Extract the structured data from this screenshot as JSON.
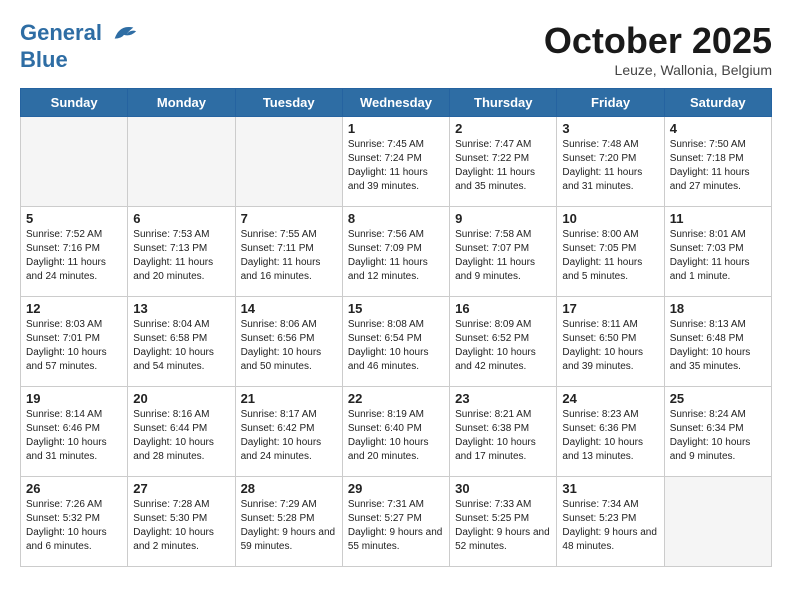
{
  "header": {
    "logo_line1": "General",
    "logo_line2": "Blue",
    "month": "October 2025",
    "location": "Leuze, Wallonia, Belgium"
  },
  "weekdays": [
    "Sunday",
    "Monday",
    "Tuesday",
    "Wednesday",
    "Thursday",
    "Friday",
    "Saturday"
  ],
  "weeks": [
    [
      {
        "day": null
      },
      {
        "day": null
      },
      {
        "day": null
      },
      {
        "day": "1",
        "sunrise": "Sunrise: 7:45 AM",
        "sunset": "Sunset: 7:24 PM",
        "daylight": "Daylight: 11 hours and 39 minutes."
      },
      {
        "day": "2",
        "sunrise": "Sunrise: 7:47 AM",
        "sunset": "Sunset: 7:22 PM",
        "daylight": "Daylight: 11 hours and 35 minutes."
      },
      {
        "day": "3",
        "sunrise": "Sunrise: 7:48 AM",
        "sunset": "Sunset: 7:20 PM",
        "daylight": "Daylight: 11 hours and 31 minutes."
      },
      {
        "day": "4",
        "sunrise": "Sunrise: 7:50 AM",
        "sunset": "Sunset: 7:18 PM",
        "daylight": "Daylight: 11 hours and 27 minutes."
      }
    ],
    [
      {
        "day": "5",
        "sunrise": "Sunrise: 7:52 AM",
        "sunset": "Sunset: 7:16 PM",
        "daylight": "Daylight: 11 hours and 24 minutes."
      },
      {
        "day": "6",
        "sunrise": "Sunrise: 7:53 AM",
        "sunset": "Sunset: 7:13 PM",
        "daylight": "Daylight: 11 hours and 20 minutes."
      },
      {
        "day": "7",
        "sunrise": "Sunrise: 7:55 AM",
        "sunset": "Sunset: 7:11 PM",
        "daylight": "Daylight: 11 hours and 16 minutes."
      },
      {
        "day": "8",
        "sunrise": "Sunrise: 7:56 AM",
        "sunset": "Sunset: 7:09 PM",
        "daylight": "Daylight: 11 hours and 12 minutes."
      },
      {
        "day": "9",
        "sunrise": "Sunrise: 7:58 AM",
        "sunset": "Sunset: 7:07 PM",
        "daylight": "Daylight: 11 hours and 9 minutes."
      },
      {
        "day": "10",
        "sunrise": "Sunrise: 8:00 AM",
        "sunset": "Sunset: 7:05 PM",
        "daylight": "Daylight: 11 hours and 5 minutes."
      },
      {
        "day": "11",
        "sunrise": "Sunrise: 8:01 AM",
        "sunset": "Sunset: 7:03 PM",
        "daylight": "Daylight: 11 hours and 1 minute."
      }
    ],
    [
      {
        "day": "12",
        "sunrise": "Sunrise: 8:03 AM",
        "sunset": "Sunset: 7:01 PM",
        "daylight": "Daylight: 10 hours and 57 minutes."
      },
      {
        "day": "13",
        "sunrise": "Sunrise: 8:04 AM",
        "sunset": "Sunset: 6:58 PM",
        "daylight": "Daylight: 10 hours and 54 minutes."
      },
      {
        "day": "14",
        "sunrise": "Sunrise: 8:06 AM",
        "sunset": "Sunset: 6:56 PM",
        "daylight": "Daylight: 10 hours and 50 minutes."
      },
      {
        "day": "15",
        "sunrise": "Sunrise: 8:08 AM",
        "sunset": "Sunset: 6:54 PM",
        "daylight": "Daylight: 10 hours and 46 minutes."
      },
      {
        "day": "16",
        "sunrise": "Sunrise: 8:09 AM",
        "sunset": "Sunset: 6:52 PM",
        "daylight": "Daylight: 10 hours and 42 minutes."
      },
      {
        "day": "17",
        "sunrise": "Sunrise: 8:11 AM",
        "sunset": "Sunset: 6:50 PM",
        "daylight": "Daylight: 10 hours and 39 minutes."
      },
      {
        "day": "18",
        "sunrise": "Sunrise: 8:13 AM",
        "sunset": "Sunset: 6:48 PM",
        "daylight": "Daylight: 10 hours and 35 minutes."
      }
    ],
    [
      {
        "day": "19",
        "sunrise": "Sunrise: 8:14 AM",
        "sunset": "Sunset: 6:46 PM",
        "daylight": "Daylight: 10 hours and 31 minutes."
      },
      {
        "day": "20",
        "sunrise": "Sunrise: 8:16 AM",
        "sunset": "Sunset: 6:44 PM",
        "daylight": "Daylight: 10 hours and 28 minutes."
      },
      {
        "day": "21",
        "sunrise": "Sunrise: 8:17 AM",
        "sunset": "Sunset: 6:42 PM",
        "daylight": "Daylight: 10 hours and 24 minutes."
      },
      {
        "day": "22",
        "sunrise": "Sunrise: 8:19 AM",
        "sunset": "Sunset: 6:40 PM",
        "daylight": "Daylight: 10 hours and 20 minutes."
      },
      {
        "day": "23",
        "sunrise": "Sunrise: 8:21 AM",
        "sunset": "Sunset: 6:38 PM",
        "daylight": "Daylight: 10 hours and 17 minutes."
      },
      {
        "day": "24",
        "sunrise": "Sunrise: 8:23 AM",
        "sunset": "Sunset: 6:36 PM",
        "daylight": "Daylight: 10 hours and 13 minutes."
      },
      {
        "day": "25",
        "sunrise": "Sunrise: 8:24 AM",
        "sunset": "Sunset: 6:34 PM",
        "daylight": "Daylight: 10 hours and 9 minutes."
      }
    ],
    [
      {
        "day": "26",
        "sunrise": "Sunrise: 7:26 AM",
        "sunset": "Sunset: 5:32 PM",
        "daylight": "Daylight: 10 hours and 6 minutes."
      },
      {
        "day": "27",
        "sunrise": "Sunrise: 7:28 AM",
        "sunset": "Sunset: 5:30 PM",
        "daylight": "Daylight: 10 hours and 2 minutes."
      },
      {
        "day": "28",
        "sunrise": "Sunrise: 7:29 AM",
        "sunset": "Sunset: 5:28 PM",
        "daylight": "Daylight: 9 hours and 59 minutes."
      },
      {
        "day": "29",
        "sunrise": "Sunrise: 7:31 AM",
        "sunset": "Sunset: 5:27 PM",
        "daylight": "Daylight: 9 hours and 55 minutes."
      },
      {
        "day": "30",
        "sunrise": "Sunrise: 7:33 AM",
        "sunset": "Sunset: 5:25 PM",
        "daylight": "Daylight: 9 hours and 52 minutes."
      },
      {
        "day": "31",
        "sunrise": "Sunrise: 7:34 AM",
        "sunset": "Sunset: 5:23 PM",
        "daylight": "Daylight: 9 hours and 48 minutes."
      },
      {
        "day": null
      }
    ]
  ]
}
